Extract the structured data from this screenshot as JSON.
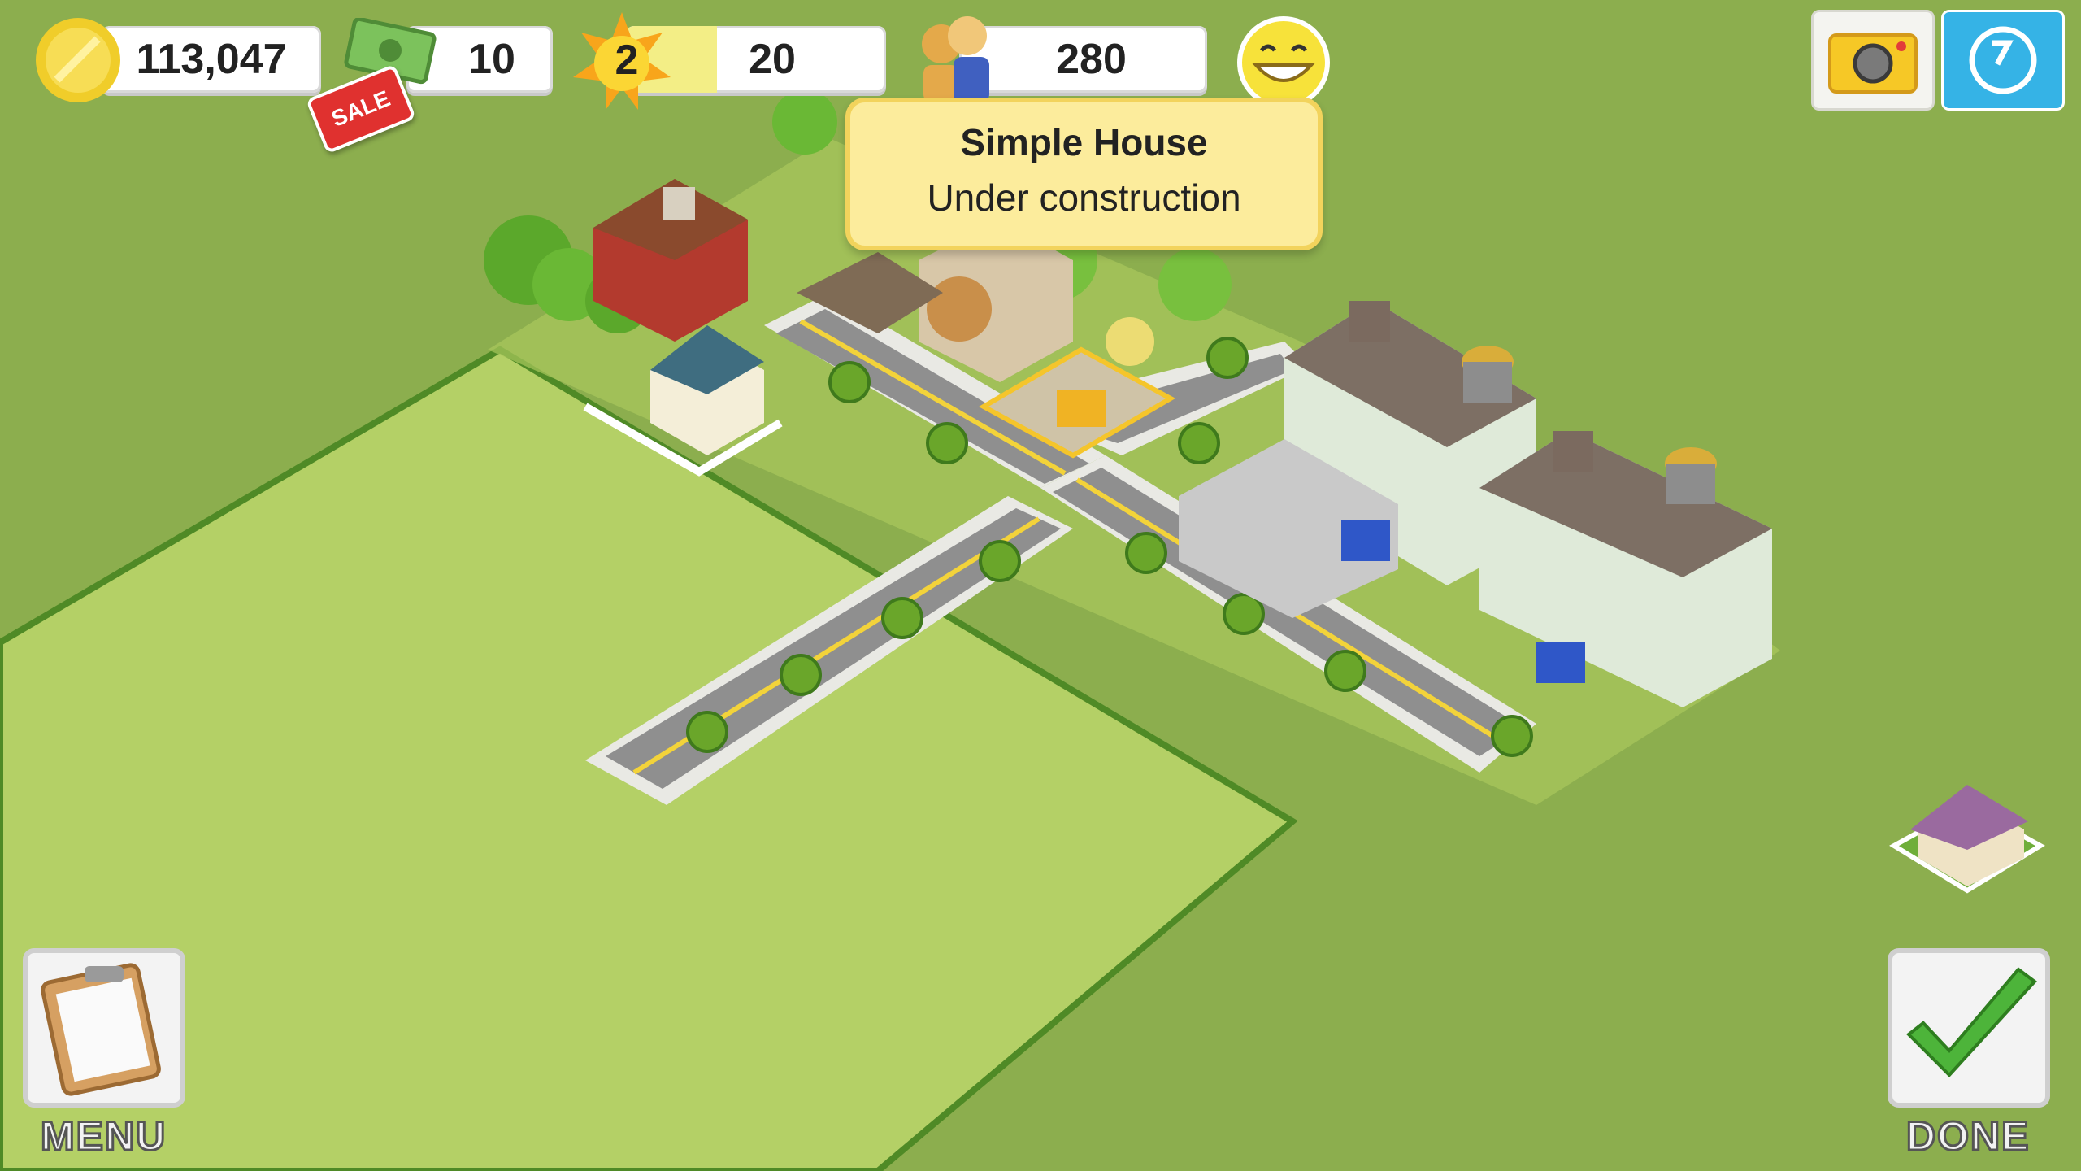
{
  "hud": {
    "coins": "113,047",
    "cash": "10",
    "sale_tag": "SALE",
    "level": "2",
    "xp": "20",
    "xp_fill_fraction": 0.35,
    "population": "280"
  },
  "tooltip": {
    "title": "Simple House",
    "subtitle": "Under construction"
  },
  "buttons": {
    "menu_label": "MENU",
    "done_label": "DONE"
  },
  "icons": {
    "coins": "coin-icon",
    "cash": "cash-icon",
    "level": "sun-level-icon",
    "population": "population-icon",
    "happiness": "smiley-icon",
    "camera": "camera-icon",
    "share": "share-icon",
    "build": "house-build-icon",
    "menu": "clipboard-icon",
    "done": "checkmark-icon"
  },
  "colors": {
    "background": "#8cae4e",
    "ground": "#b4d066",
    "ground_edge": "#4f8a26",
    "road": "#9a9a9a",
    "road_line": "#f3d33a",
    "tooltip": "#fcec9c"
  }
}
